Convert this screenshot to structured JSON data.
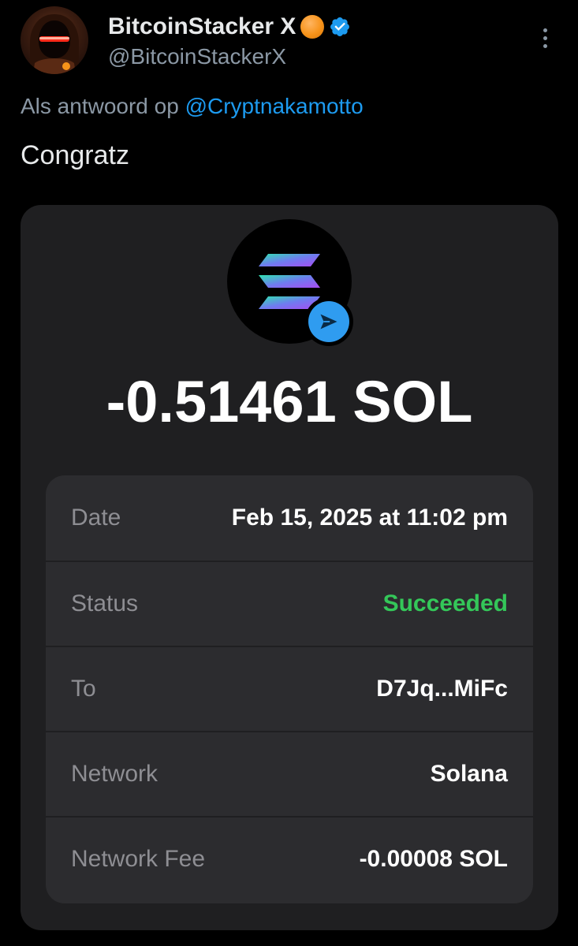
{
  "tweet": {
    "author_name": "BitcoinStacker X",
    "handle": "@BitcoinStackerX",
    "reply_prefix": "Als antwoord op",
    "reply_to": "@Cryptnakamotto",
    "text": "Congratz"
  },
  "transaction": {
    "amount": "-0.51461 SOL",
    "rows": [
      {
        "label": "Date",
        "value": "Feb 15, 2025 at 11:02 pm"
      },
      {
        "label": "Status",
        "value": "Succeeded"
      },
      {
        "label": "To",
        "value": "D7Jq...MiFc"
      },
      {
        "label": "Network",
        "value": "Solana"
      },
      {
        "label": "Network Fee",
        "value": "-0.00008 SOL"
      }
    ]
  },
  "icons": {
    "verified": "verified-badge-icon",
    "emoji": "orange-circle-emoji",
    "more": "more-options-icon",
    "token": "solana-logo-icon",
    "send": "send-arrow-icon"
  },
  "colors": {
    "background": "#000000",
    "mention": "#1d9bf0",
    "verified": "#1d9bf0",
    "card": "#1f1f21",
    "details_panel": "#2c2c2f",
    "success": "#34c759",
    "send_badge": "#2f9cf0"
  }
}
